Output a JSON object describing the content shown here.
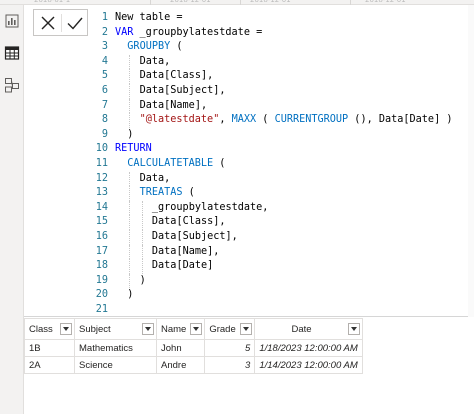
{
  "top_strip": {
    "fragments": [
      "2018-01-1",
      "2018-12-01",
      "2018-12-01",
      "2018-12-01"
    ]
  },
  "left_rail": {
    "icons": [
      "report-view-icon",
      "data-view-icon",
      "model-view-icon"
    ]
  },
  "formula_bar": {
    "cancel_icon": "close-icon",
    "commit_icon": "checkmark-icon",
    "lines": [
      {
        "n": "1",
        "t": "New table = "
      },
      {
        "n": "2",
        "t": "VAR _groupbylatestdate ="
      },
      {
        "n": "3",
        "t": "GROUPBY ("
      },
      {
        "n": "4",
        "t": "Data,"
      },
      {
        "n": "5",
        "t": "Data[Class],"
      },
      {
        "n": "6",
        "t": "Data[Subject],"
      },
      {
        "n": "7",
        "t": "Data[Name],"
      },
      {
        "n": "8",
        "t": "\"@latestdate\", MAXX ( CURRENTGROUP (), Data[Date] )"
      },
      {
        "n": "9",
        "t": ")"
      },
      {
        "n": "10",
        "t": "RETURN"
      },
      {
        "n": "11",
        "t": "CALCULATETABLE ("
      },
      {
        "n": "12",
        "t": "Data,"
      },
      {
        "n": "13",
        "t": "TREATAS ("
      },
      {
        "n": "14",
        "t": "_groupbylatestdate,"
      },
      {
        "n": "15",
        "t": "Data[Class],"
      },
      {
        "n": "16",
        "t": "Data[Subject],"
      },
      {
        "n": "17",
        "t": "Data[Name],"
      },
      {
        "n": "18",
        "t": "Data[Date]"
      },
      {
        "n": "19",
        "t": ")"
      },
      {
        "n": "20",
        "t": ")"
      },
      {
        "n": "21",
        "t": ""
      }
    ]
  },
  "grid": {
    "columns": [
      "Class",
      "Subject",
      "Name",
      "Grade",
      "Date"
    ],
    "rows": [
      [
        "1B",
        "Mathematics",
        "John",
        "5",
        "1/18/2023 12:00:00 AM"
      ],
      [
        "2A",
        "Science",
        "Andre",
        "3",
        "1/14/2023 12:00:00 AM"
      ]
    ]
  },
  "colors": {
    "keyword": "#0000ff",
    "function": "#0070c1",
    "string": "#a31515",
    "line_number": "#237893"
  }
}
